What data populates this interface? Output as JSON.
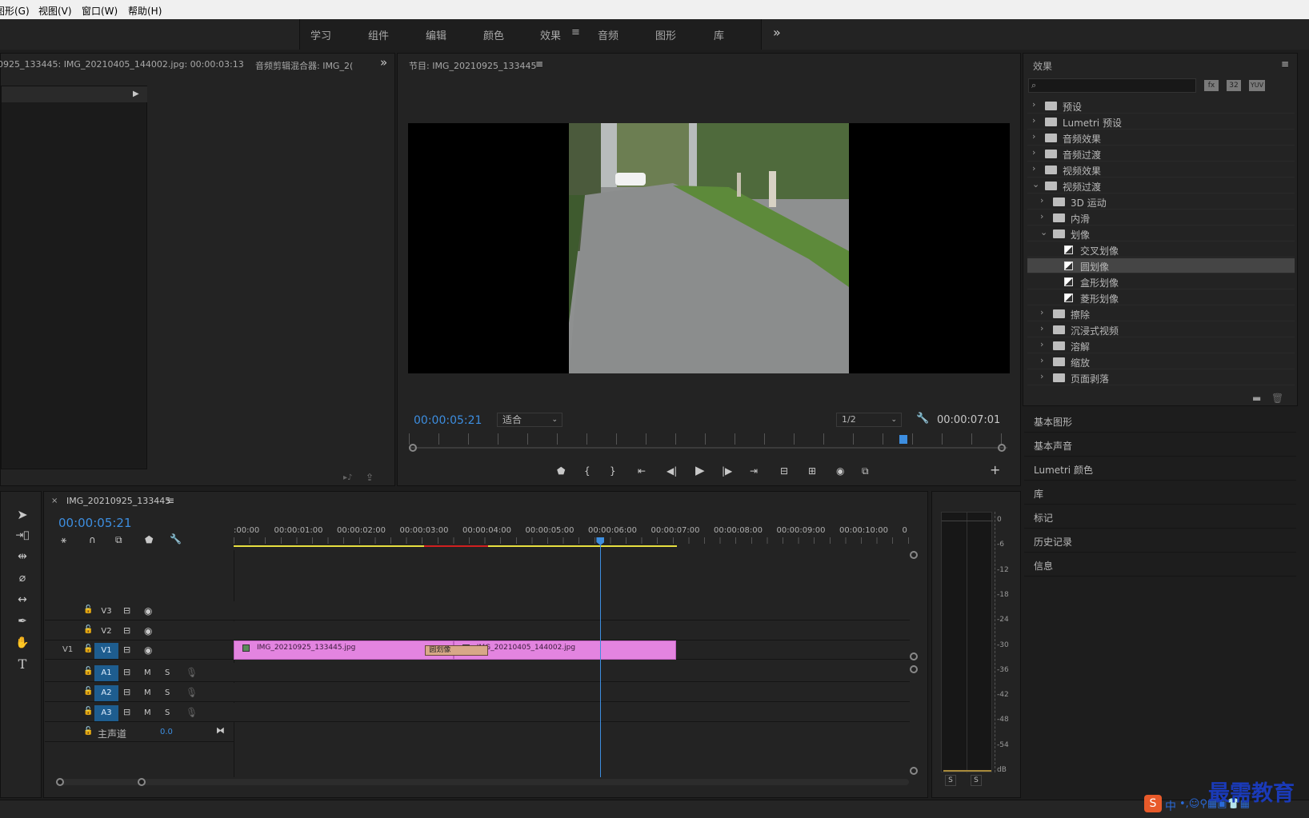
{
  "menu": {
    "graphics": "图形(G)",
    "view": "视图(V)",
    "window": "窗口(W)",
    "help": "帮助(H)"
  },
  "workspaces": [
    {
      "label": "学习"
    },
    {
      "label": "组件"
    },
    {
      "label": "编辑"
    },
    {
      "label": "颜色"
    },
    {
      "label": "效果",
      "active": true
    },
    {
      "label": "音频"
    },
    {
      "label": "图形"
    },
    {
      "label": "库"
    }
  ],
  "source_panel": {
    "tab1": "0925_133445: IMG_20210405_144002.jpg: 00:00:03:13",
    "tab2": "音频剪辑混合器: IMG_2("
  },
  "program": {
    "title": "节目: IMG_20210925_133445",
    "timecode": "00:00:05:21",
    "fit": "适合",
    "quality": "1/2",
    "duration": "00:00:07:01",
    "playhead_fraction": 0.82
  },
  "effects": {
    "title": "效果",
    "search_placeholder": "",
    "tags": [
      "32",
      "YUV"
    ],
    "tree": [
      {
        "label": "预设",
        "level": 0,
        "open": false,
        "kind": "folder"
      },
      {
        "label": "Lumetri 预设",
        "level": 0,
        "open": false,
        "kind": "folder"
      },
      {
        "label": "音频效果",
        "level": 0,
        "open": false,
        "kind": "folder"
      },
      {
        "label": "音频过渡",
        "level": 0,
        "open": false,
        "kind": "folder"
      },
      {
        "label": "视频效果",
        "level": 0,
        "open": false,
        "kind": "folder"
      },
      {
        "label": "视频过渡",
        "level": 0,
        "open": true,
        "kind": "folder"
      },
      {
        "label": "3D 运动",
        "level": 1,
        "open": false,
        "kind": "folder"
      },
      {
        "label": "内滑",
        "level": 1,
        "open": false,
        "kind": "folder"
      },
      {
        "label": "划像",
        "level": 1,
        "open": true,
        "kind": "folder"
      },
      {
        "label": "交叉划像",
        "level": 2,
        "kind": "effect"
      },
      {
        "label": "圆划像",
        "level": 2,
        "kind": "effect",
        "selected": true
      },
      {
        "label": "盒形划像",
        "level": 2,
        "kind": "effect"
      },
      {
        "label": "菱形划像",
        "level": 2,
        "kind": "effect"
      },
      {
        "label": "擦除",
        "level": 1,
        "open": false,
        "kind": "folder"
      },
      {
        "label": "沉浸式视频",
        "level": 1,
        "open": false,
        "kind": "folder"
      },
      {
        "label": "溶解",
        "level": 1,
        "open": false,
        "kind": "folder"
      },
      {
        "label": "缩放",
        "level": 1,
        "open": false,
        "kind": "folder"
      },
      {
        "label": "页面剥落",
        "level": 1,
        "open": false,
        "kind": "folder"
      }
    ]
  },
  "side_sections": [
    "基本图形",
    "基本声音",
    "Lumetri 颜色",
    "库",
    "标记",
    "历史记录",
    "信息"
  ],
  "timeline": {
    "sequence": "IMG_20210925_133445",
    "timecode": "00:00:05:21",
    "ruler": [
      ":00:00",
      "00:00:01:00",
      "00:00:02:00",
      "00:00:03:00",
      "00:00:04:00",
      "00:00:05:00",
      "00:00:06:00",
      "00:00:07:00",
      "00:00:08:00",
      "00:00:09:00",
      "00:00:10:00",
      "0"
    ],
    "video_tracks": [
      {
        "name": "V3"
      },
      {
        "name": "V2"
      },
      {
        "name": "V1",
        "src": "V1"
      }
    ],
    "audio_tracks": [
      {
        "name": "A1"
      },
      {
        "name": "A2"
      },
      {
        "name": "A3"
      }
    ],
    "track_buttons": {
      "m": "M",
      "s": "S"
    },
    "master": {
      "label": "主声道",
      "value": "0.0"
    },
    "clips": [
      {
        "name": "IMG_20210925_133445.jpg",
        "start": 0,
        "end": 3.5
      },
      {
        "name": "IMG_20210405_144002.jpg",
        "start": 3.5,
        "end": 7.04
      }
    ],
    "transition": {
      "name": "圆划像",
      "start": 3.05,
      "end": 4.05
    },
    "playhead_seconds": 5.84,
    "visible_seconds": 10.75
  },
  "meter": {
    "scale": [
      "0",
      "-6",
      "-12",
      "-18",
      "-24",
      "-30",
      "-36",
      "-42",
      "-48",
      "-54",
      "dB"
    ],
    "solo": [
      "S",
      "S"
    ]
  },
  "watermark": "最需教育",
  "ime": "中",
  "colors": {
    "accent": "#3d8ee0",
    "clip": "#e384e0",
    "transition": "#d8a888",
    "work_bar": "#e8e040",
    "render_red": "#d02020"
  }
}
